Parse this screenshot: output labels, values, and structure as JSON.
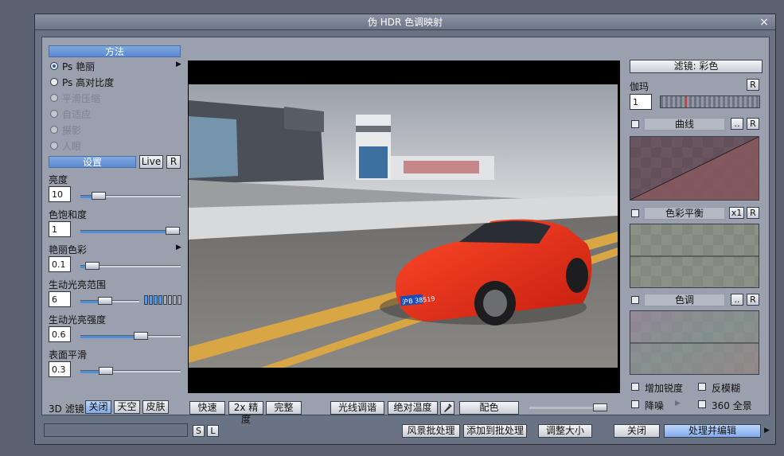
{
  "window": {
    "title": "伪 HDR 色调映射",
    "close_glyph": "×"
  },
  "method": {
    "header": "方法",
    "options": [
      {
        "label": "Ps 艳丽",
        "selected": true,
        "enabled": true,
        "has_arrow": true
      },
      {
        "label": "Ps 高对比度",
        "selected": false,
        "enabled": true
      },
      {
        "label": "平滑压缩",
        "selected": false,
        "enabled": false
      },
      {
        "label": "自适应",
        "selected": false,
        "enabled": false
      },
      {
        "label": "摄影",
        "selected": false,
        "enabled": false
      },
      {
        "label": "人眼",
        "selected": false,
        "enabled": false
      }
    ]
  },
  "settings": {
    "header": "设置",
    "live_label": "Live",
    "reset_label": "R",
    "sliders": [
      {
        "label": "亮度",
        "value": "10",
        "fraction": 0.18
      },
      {
        "label": "色饱和度",
        "value": "1",
        "fraction": 0.92
      },
      {
        "label": "艳丽色彩",
        "value": "0.1",
        "fraction": 0.12,
        "has_arrow": true
      },
      {
        "label": "生动光亮范围",
        "value": "6",
        "fraction": 0.42,
        "has_bars": true
      },
      {
        "label": "生动光亮强度",
        "value": "0.6",
        "fraction": 0.6
      },
      {
        "label": "表面平滑",
        "value": "0.3",
        "fraction": 0.25
      }
    ],
    "range_bars": {
      "total": 8,
      "active": 4
    }
  },
  "filter3d": {
    "label": "3D 滤镜",
    "options": [
      "关闭",
      "天空",
      "皮肤"
    ],
    "selected": 0
  },
  "preview_buttons": {
    "fast": "快速",
    "precise": "2x 精度",
    "full": "完整",
    "light": "光线调谐",
    "abs_temp": "绝对温度",
    "color_match": "配色",
    "slider_fraction": 1.0
  },
  "right": {
    "filter_button": "滤镜: 彩色",
    "gamma": {
      "label": "伽玛",
      "value": "1",
      "reset": "R"
    },
    "curves": {
      "label": "曲线",
      "more": "..",
      "reset": "R",
      "checked": false
    },
    "color_balance": {
      "label": "色彩平衡",
      "x1": "x1",
      "reset": "R",
      "checked": false
    },
    "hue": {
      "label": "色调",
      "more": "..",
      "reset": "R",
      "checked": false
    },
    "checks": [
      {
        "label": "增加锐度",
        "checked": false
      },
      {
        "label": "反模糊",
        "checked": false
      },
      {
        "label": "降噪",
        "checked": false,
        "has_arrow": true
      },
      {
        "label": "360 全景",
        "checked": false
      }
    ]
  },
  "preview_image": {
    "plate_text": "沪B 38519"
  },
  "bottom": {
    "s_label": "S",
    "l_label": "L",
    "scene_batch": "风景批处理",
    "add_batch": "添加到批处理",
    "resize": "调整大小",
    "close": "关闭",
    "process_edit": "处理并编辑"
  }
}
